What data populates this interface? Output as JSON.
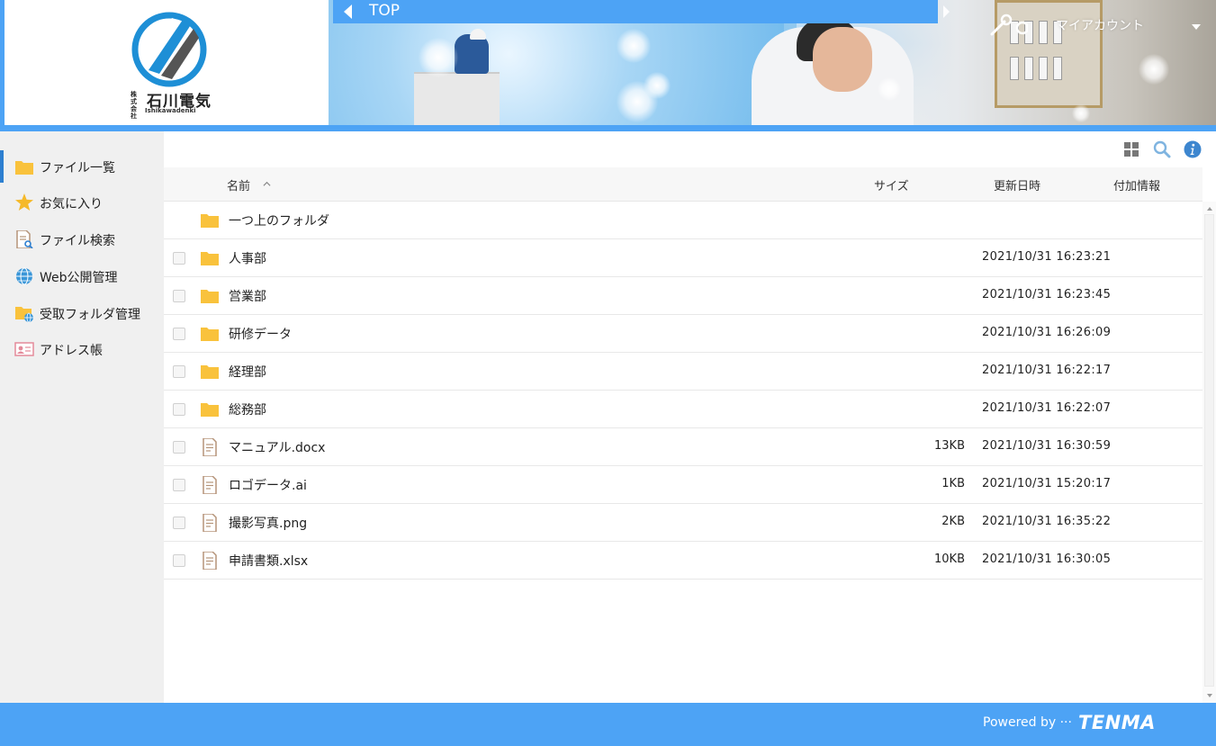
{
  "header": {
    "logo": {
      "kk": "株式会社",
      "name": "石川電気",
      "sub": "Ishikawadenki"
    },
    "top_label": "TOP",
    "account_label": "マイアカウント"
  },
  "sidebar": {
    "items": [
      {
        "label": "ファイル一覧",
        "icon": "folder-icon"
      },
      {
        "label": "お気に入り",
        "icon": "star-icon"
      },
      {
        "label": "ファイル検索",
        "icon": "file-search-icon"
      },
      {
        "label": "Web公開管理",
        "icon": "globe-icon"
      },
      {
        "label": "受取フォルダ管理",
        "icon": "folder-globe-icon"
      },
      {
        "label": "アドレス帳",
        "icon": "address-card-icon"
      }
    ]
  },
  "toolbar": {
    "icons": [
      "grid-view-icon",
      "search-icon",
      "info-icon"
    ]
  },
  "table": {
    "headers": {
      "name": "名前",
      "size": "サイズ",
      "updated": "更新日時",
      "extra": "付加情報"
    },
    "parent_row": {
      "name": "一つ上のフォルダ"
    },
    "rows": [
      {
        "type": "folder",
        "name": "人事部",
        "size": "",
        "date": "2021/10/31 16:23:21"
      },
      {
        "type": "folder",
        "name": "営業部",
        "size": "",
        "date": "2021/10/31 16:23:45"
      },
      {
        "type": "folder",
        "name": "研修データ",
        "size": "",
        "date": "2021/10/31 16:26:09"
      },
      {
        "type": "folder",
        "name": "経理部",
        "size": "",
        "date": "2021/10/31 16:22:17"
      },
      {
        "type": "folder",
        "name": "総務部",
        "size": "",
        "date": "2021/10/31 16:22:07"
      },
      {
        "type": "file",
        "name": "マニュアル.docx",
        "size": "13KB",
        "date": "2021/10/31 16:30:59"
      },
      {
        "type": "file",
        "name": "ロゴデータ.ai",
        "size": "1KB",
        "date": "2021/10/31 15:20:17"
      },
      {
        "type": "file",
        "name": "撮影写真.png",
        "size": "2KB",
        "date": "2021/10/31 16:35:22"
      },
      {
        "type": "file",
        "name": "申請書類.xlsx",
        "size": "10KB",
        "date": "2021/10/31 16:30:05"
      }
    ]
  },
  "footer": {
    "powered_by": "Powered by ···",
    "brand": "TENMA"
  },
  "colors": {
    "accent": "#4da3f5",
    "folder": "#f9c23c",
    "active_indicator": "#2d7fd0"
  }
}
